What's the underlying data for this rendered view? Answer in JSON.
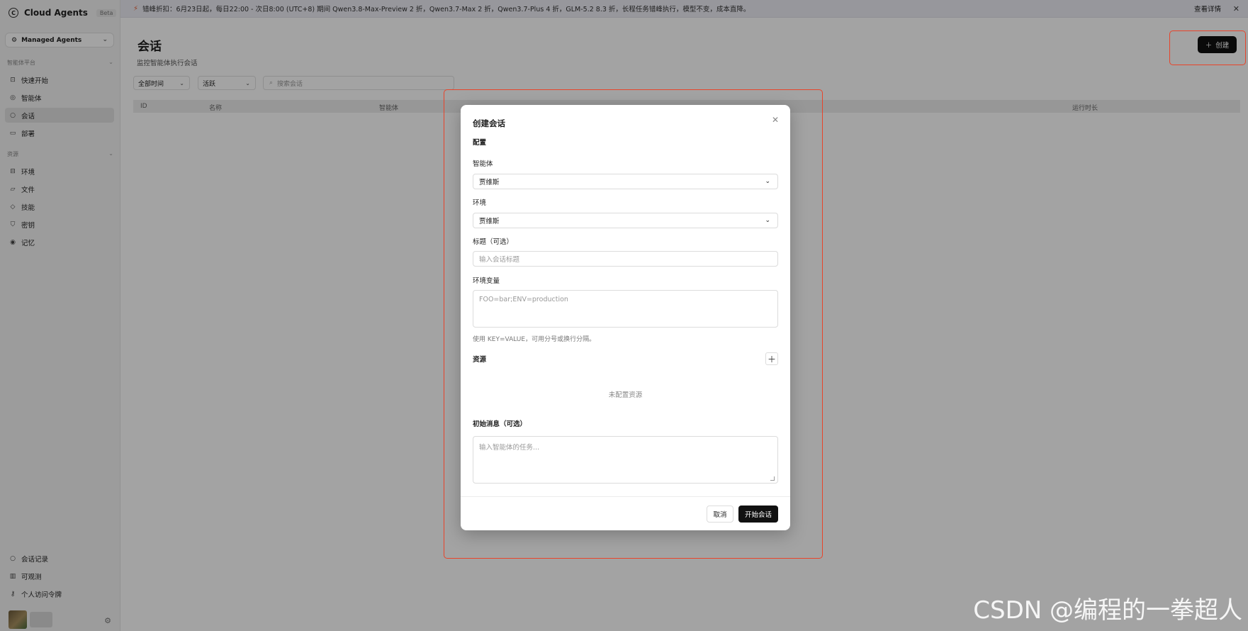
{
  "app": {
    "name": "Cloud Agents",
    "badge": "Beta",
    "workspace": "Managed Agents"
  },
  "banner": {
    "text": "错峰折扣：6月23日起，每日22:00 - 次日8:00 (UTC+8) 期间 Qwen3.8-Max-Preview 2 折，Qwen3.7-Max 2 折，Qwen3.7-Plus 4 折，GLM-5.2 8.3 折，长程任务错峰执行，模型不变，成本直降。",
    "details": "查看详情",
    "close": "✕"
  },
  "sidebar": {
    "section1": "智能体平台",
    "items1": [
      {
        "label": "快速开始",
        "icon": "lock-icon"
      },
      {
        "label": "智能体",
        "icon": "agent-icon"
      },
      {
        "label": "会话",
        "icon": "chat-icon"
      },
      {
        "label": "部署",
        "icon": "deploy-icon"
      }
    ],
    "section2": "资源",
    "items2": [
      {
        "label": "环境",
        "icon": "grid-icon"
      },
      {
        "label": "文件",
        "icon": "folder-icon"
      },
      {
        "label": "技能",
        "icon": "skill-icon"
      },
      {
        "label": "密钥",
        "icon": "shield-icon"
      },
      {
        "label": "记忆",
        "icon": "memory-icon"
      }
    ],
    "bottom": [
      {
        "label": "会话记录",
        "icon": "history-icon"
      },
      {
        "label": "可观测",
        "icon": "chart-icon"
      },
      {
        "label": "个人访问令牌",
        "icon": "key-icon"
      }
    ]
  },
  "page": {
    "title": "会话",
    "subtitle": "监控智能体执行会话",
    "create": "创建",
    "filter_time": "全部时间",
    "filter_status": "活跃",
    "search_placeholder": "搜索会话",
    "columns": [
      "ID",
      "名称",
      "智能体",
      "",
      "",
      "运行时长"
    ]
  },
  "modal": {
    "title": "创建会话",
    "section": "配置",
    "agent_label": "智能体",
    "agent_value": "贾维斯",
    "env_label": "环境",
    "env_value": "贾维斯",
    "title_label": "标题（可选）",
    "title_placeholder": "输入会话标题",
    "envvars_label": "环境变量",
    "envvars_placeholder": "FOO=bar;ENV=production",
    "envvars_hint": "使用 KEY=VALUE，可用分号或换行分隔。",
    "resources_label": "资源",
    "resources_empty": "未配置资源",
    "init_label": "初始消息（可选）",
    "init_placeholder": "输入智能体的任务...",
    "cancel": "取消",
    "start": "开始会话"
  },
  "watermark": "CSDN @编程的一拳超人"
}
